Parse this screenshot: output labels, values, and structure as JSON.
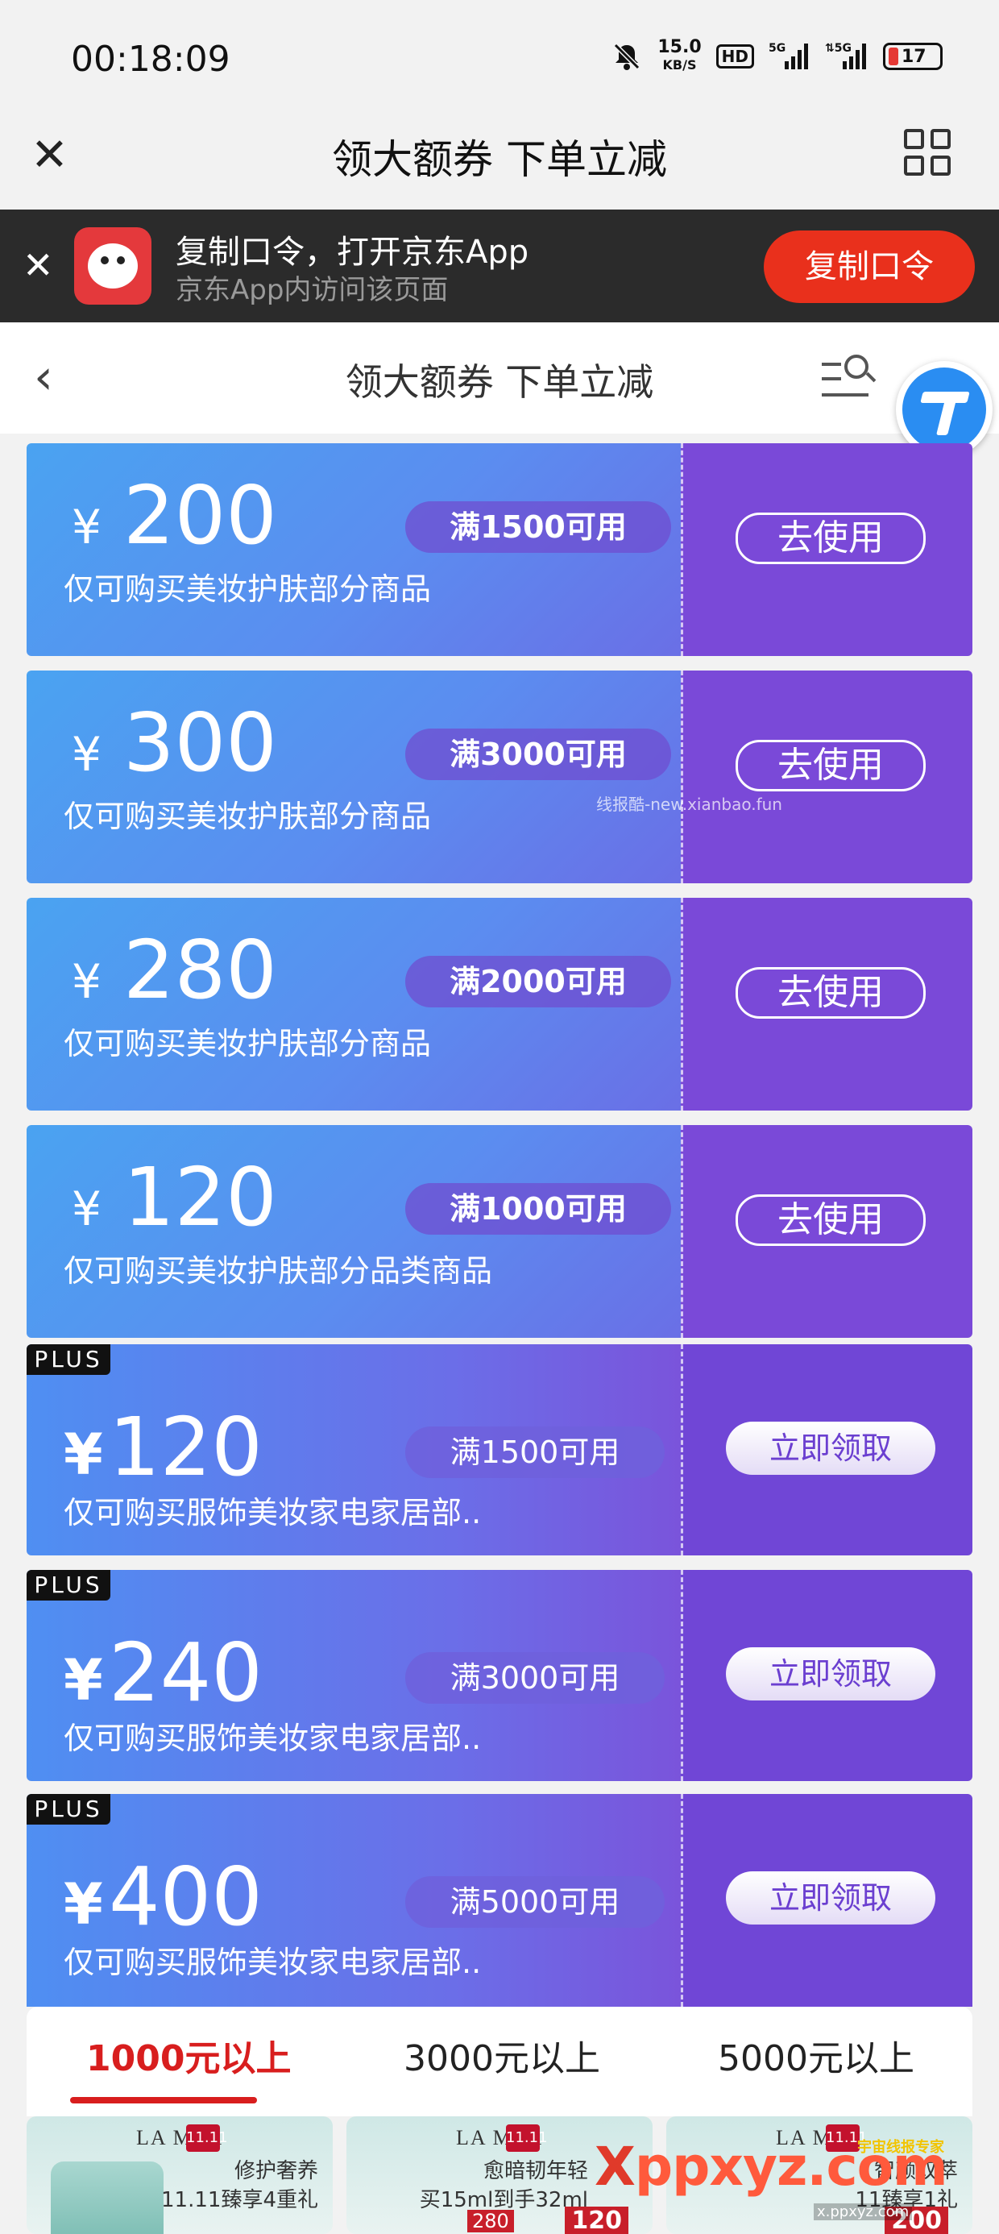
{
  "status_bar": {
    "time": "00:18:09",
    "speed_value": "15.0",
    "speed_unit": "KB/S",
    "hd_label": "HD",
    "net1": "5G",
    "net2": "5G",
    "battery_level": "17",
    "icons": [
      "mute-bell-icon",
      "signal-icon",
      "signal-icon",
      "battery-icon"
    ]
  },
  "top_bar": {
    "title": "领大额券 下单立减",
    "close_icon": "close-icon",
    "menu_icon": "grid-menu-icon"
  },
  "app_banner": {
    "title": "复制口令，打开京东App",
    "subtitle": "京东App内访问该页面",
    "button_label": "复制口令",
    "accent": "#e9301c"
  },
  "page_header": {
    "title": "领大额券 下单立减",
    "back_icon": "back-chevron-icon",
    "search_menu_icon": "search-list-icon"
  },
  "coupons": [
    {
      "currency": "¥",
      "amount": "200",
      "condition": "满1500可用",
      "description": "仅可购买美妆护肤部分商品",
      "action": "去使用",
      "plus": false
    },
    {
      "currency": "¥",
      "amount": "300",
      "condition": "满3000可用",
      "description": "仅可购买美妆护肤部分商品",
      "action": "去使用",
      "plus": false
    },
    {
      "currency": "¥",
      "amount": "280",
      "condition": "满2000可用",
      "description": "仅可购买美妆护肤部分商品",
      "action": "去使用",
      "plus": false
    },
    {
      "currency": "¥",
      "amount": "120",
      "condition": "满1000可用",
      "description": "仅可购买美妆护肤部分品类商品",
      "action": "去使用",
      "plus": false
    },
    {
      "tag": "PLUS",
      "currency": "¥",
      "amount": "120",
      "condition": "满1500可用",
      "description": "仅可购买服饰美妆家电家居部..",
      "action": "立即领取",
      "plus": true
    },
    {
      "tag": "PLUS",
      "currency": "¥",
      "amount": "240",
      "condition": "满3000可用",
      "description": "仅可购买服饰美妆家电家居部..",
      "action": "立即领取",
      "plus": true
    },
    {
      "tag": "PLUS",
      "currency": "¥",
      "amount": "400",
      "condition": "满5000可用",
      "description": "仅可购买服饰美妆家电家居部..",
      "action": "立即领取",
      "plus": true
    }
  ],
  "watermark_small": "线报酷-new.xianbao.fun",
  "tabs": [
    "1000元以上",
    "3000元以上",
    "5000元以上"
  ],
  "active_tab": "1000元以上",
  "products": [
    {
      "brand": "LA MER",
      "badge": "11.11",
      "text1": "修护奢养",
      "text2": "11.11臻享4重礼"
    },
    {
      "brand": "LA MER",
      "badge": "11.11",
      "text1": "愈暗韧年轻",
      "text2": "买15ml到手32ml",
      "price_a": "280",
      "price_b": "120"
    },
    {
      "brand": "LA MER",
      "badge": "11.11",
      "text1": "智颜双萃",
      "text2": "11臻享1礼",
      "price_b": "200"
    }
  ],
  "watermark_logo": {
    "x": "X",
    "rest": "ppxyz.com",
    "small": "x.ppxyz.com",
    "top": "宇宙线报专家"
  }
}
